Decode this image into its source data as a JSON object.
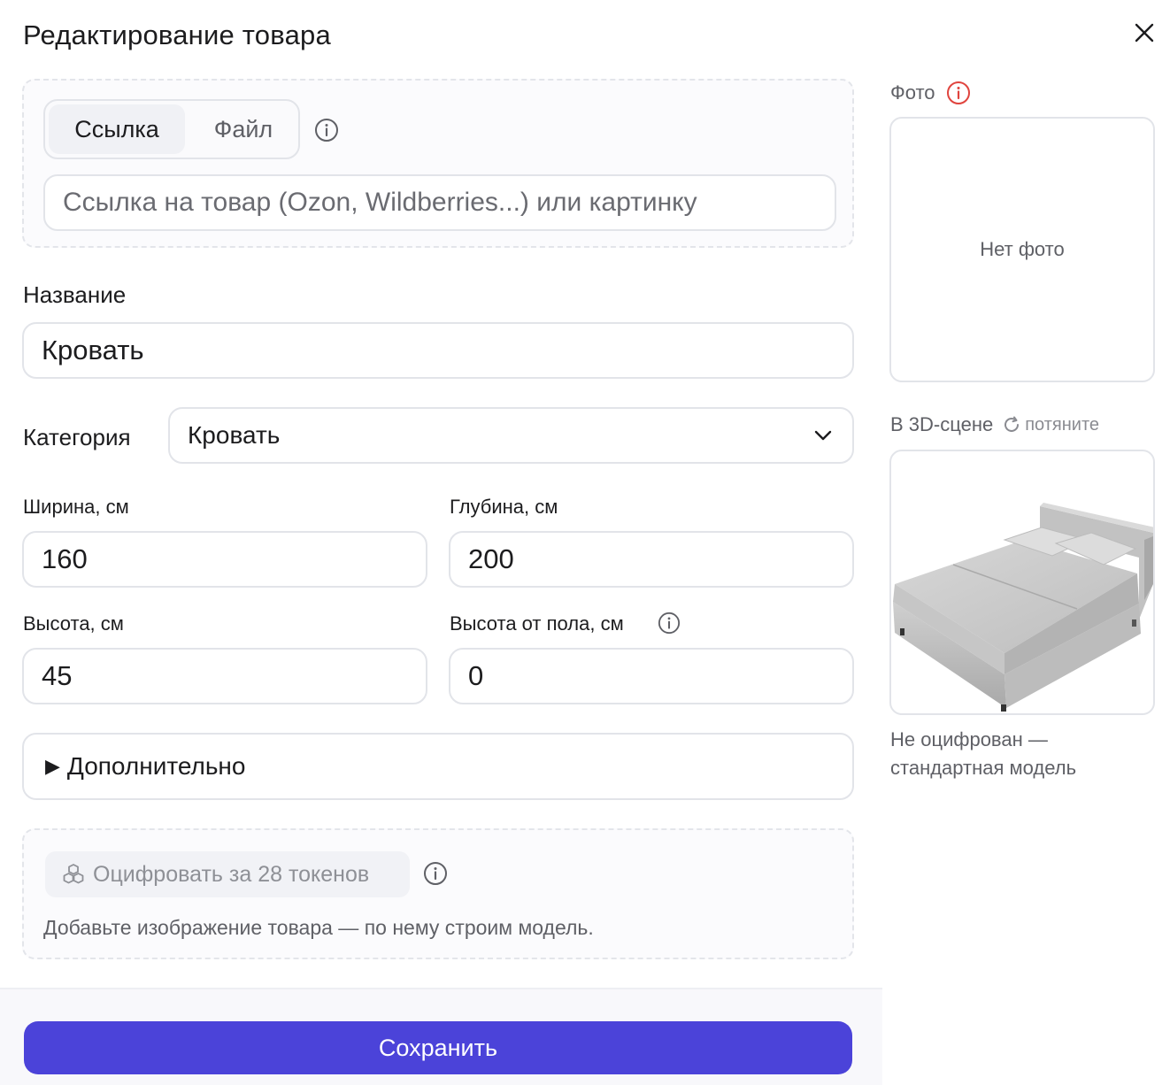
{
  "dialog": {
    "title": "Редактирование товара",
    "close_icon": "close-icon"
  },
  "source": {
    "tabs": [
      {
        "label": "Ссылка",
        "active": true
      },
      {
        "label": "Файл",
        "active": false
      }
    ],
    "info_icon": "info-icon",
    "url_placeholder": "Ссылка на товар (Ozon, Wildberries...) или картинку",
    "url_value": ""
  },
  "name": {
    "label": "Название",
    "value": "Кровать"
  },
  "category": {
    "label": "Категория",
    "selected": "Кровать",
    "icon": "chevron-down-icon"
  },
  "dimensions": {
    "width": {
      "label": "Ширина, см",
      "value": "160"
    },
    "depth": {
      "label": "Глубина, см",
      "value": "200"
    },
    "height": {
      "label": "Высота, см",
      "value": "45"
    },
    "floor_height": {
      "label": "Высота от пола, см",
      "value": "0",
      "info_icon": "info-icon"
    }
  },
  "extra": {
    "label": "Дополнительно",
    "icon": "triangle-right-icon"
  },
  "digitize": {
    "button_label": "Оцифровать за 28 токенов",
    "button_icon": "cubes-icon",
    "info_icon": "info-icon",
    "hint": "Добавьте изображение товара — по нему строим модель."
  },
  "footer": {
    "save_label": "Сохранить",
    "accent_color": "#4b43d9"
  },
  "preview": {
    "photo_label": "Фото",
    "photo_alert_icon": "alert-circle-icon",
    "photo_alert_color": "#e0443e",
    "photo_empty": "Нет фото",
    "scene_label": "В 3D-сцене",
    "drag_icon": "rotate-icon",
    "drag_hint": "потяните",
    "scene_object_icon": "bed-model-icon",
    "note_line1": "Не оцифрован —",
    "note_line2": "стандартная модель"
  }
}
